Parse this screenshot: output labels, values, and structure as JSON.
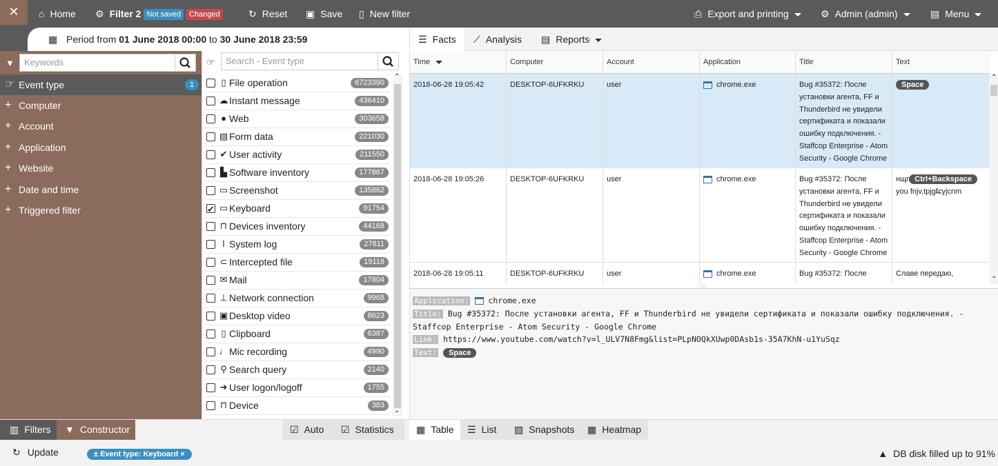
{
  "topbar": {
    "home": "Home",
    "filter_name": "Filter 2",
    "not_saved": "Not saved",
    "changed": "Changed",
    "reset": "Reset",
    "save": "Save",
    "new_filter": "New filter",
    "export": "Export and printing",
    "admin": "Admin (admin)",
    "menu": "Menu"
  },
  "period": {
    "prefix": "Period from",
    "from": "01 June 2018 00:00",
    "to_word": "to",
    "to": "30 June 2018 23:59"
  },
  "left": {
    "keywords_placeholder": "Keywords",
    "categories": [
      {
        "label": "Event type",
        "count": "1"
      },
      {
        "label": "Computer"
      },
      {
        "label": "Account"
      },
      {
        "label": "Application"
      },
      {
        "label": "Website"
      },
      {
        "label": "Date and time"
      },
      {
        "label": "Triggered filter"
      }
    ]
  },
  "middle": {
    "search_placeholder": "Search - Event type",
    "events": [
      {
        "label": "File operation",
        "count": "6723390",
        "icon": "file-icon",
        "checked": false
      },
      {
        "label": "Instant message",
        "count": "436410",
        "icon": "chat-icon",
        "checked": false
      },
      {
        "label": "Web",
        "count": "303658",
        "icon": "globe-icon",
        "checked": false
      },
      {
        "label": "Form data",
        "count": "221030",
        "icon": "form-icon",
        "checked": false
      },
      {
        "label": "User activity",
        "count": "211550",
        "icon": "check-circle-icon",
        "checked": false
      },
      {
        "label": "Software inventory",
        "count": "177867",
        "icon": "boxes-icon",
        "checked": false
      },
      {
        "label": "Screenshot",
        "count": "135862",
        "icon": "window-icon",
        "checked": false
      },
      {
        "label": "Keyboard",
        "count": "91754",
        "icon": "keyboard-icon",
        "checked": true
      },
      {
        "label": "Devices inventory",
        "count": "44168",
        "icon": "plug-icon",
        "checked": false
      },
      {
        "label": "System log",
        "count": "27811",
        "icon": "thermometer-icon",
        "checked": false
      },
      {
        "label": "Intercepted file",
        "count": "19118",
        "icon": "paperclip-icon",
        "checked": false
      },
      {
        "label": "Mail",
        "count": "17804",
        "icon": "envelope-icon",
        "checked": false
      },
      {
        "label": "Network connection",
        "count": "9968",
        "icon": "network-icon",
        "checked": false
      },
      {
        "label": "Desktop video",
        "count": "8623",
        "icon": "video-icon",
        "checked": false
      },
      {
        "label": "Clipboard",
        "count": "6387",
        "icon": "clipboard-icon",
        "checked": false
      },
      {
        "label": "Mic recording",
        "count": "4990",
        "icon": "mic-icon",
        "checked": false
      },
      {
        "label": "Search query",
        "count": "2140",
        "icon": "search-icon",
        "checked": false
      },
      {
        "label": "User logon/logoff",
        "count": "1755",
        "icon": "sign-in-icon",
        "checked": false
      },
      {
        "label": "Device",
        "count": "383",
        "icon": "plug-icon",
        "checked": false
      }
    ]
  },
  "right": {
    "tabs": [
      "Facts",
      "Analysis",
      "Reports"
    ],
    "columns": [
      "Time",
      "Computer",
      "Account",
      "Application",
      "Title",
      "Text"
    ],
    "rows": [
      {
        "time": "2018-06-28 19:05:42",
        "computer": "DESKTOP-6UFKRKU",
        "account": "user",
        "application": "chrome.exe",
        "title": "Bug #35372: После установки агента, FF и Thunderbird не увидели сертификата и показали ошибку подключения. - Staffcop Enterprise - Atom Security - Google Chrome",
        "text_chip": "Space",
        "text_before": "",
        "text_after": ""
      },
      {
        "time": "2018-06-28 19:05:26",
        "computer": "DESKTOP-6UFKRKU",
        "account": "user",
        "application": "chrome.exe",
        "title": "Bug #35372: После установки агента, FF и Thunderbird не увидели сертификата и показали ошибку подключения. - Staffcop Enterprise - Atom Security - Google Chrome",
        "text_chip": "Ctrl+Backspace",
        "text_before": "нщг",
        "text_after": "you fnjv,tpjgf̶cyjcnm"
      },
      {
        "time": "2018-06-28 19:05:11",
        "computer": "DESKTOP-6UFKRKU",
        "account": "user",
        "application": "chrome.exe",
        "title": "Bug #35372: После",
        "text_chip": "",
        "text_before": "Славе передаю,",
        "text_after": ""
      }
    ],
    "details": {
      "app_label": "Application:",
      "app_value": "chrome.exe",
      "title_label": "Title:",
      "title_value": "Bug #35372: После установки агента, FF и Thunderbird не увидели сертификата и показали ошибку подключения. - Staffcop Enterprise - Atom Security - Google Chrome",
      "link_label": "Link:",
      "link_value": "https://www.youtube.com/watch?v=l_ULV7N8Fmg&list=PLpNOQkXUwp0DAsb1s-35A7KhN-u1YuSqz",
      "text_label": "Text:",
      "text_chip": "Space"
    }
  },
  "bottom": {
    "filters": "Filters",
    "constructor": "Constructor",
    "auto": "Auto",
    "statistics": "Statistics",
    "table": "Table",
    "list": "List",
    "snapshots": "Snapshots",
    "heatmap": "Heatmap"
  },
  "status": {
    "update": "Update",
    "tag": "± Event type: Keyboard ×",
    "disk": "DB disk filled up to 91%"
  }
}
